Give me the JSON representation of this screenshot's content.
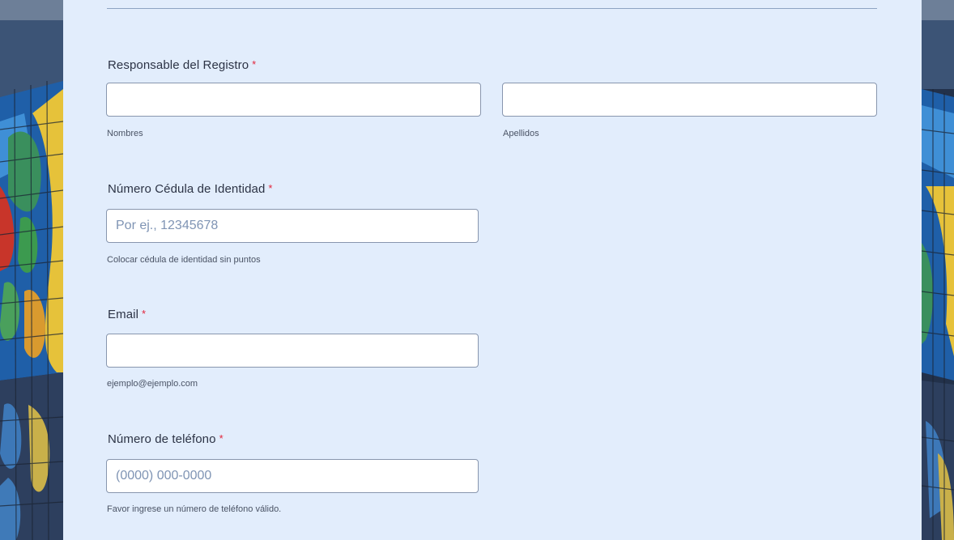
{
  "form": {
    "fields": {
      "name": {
        "label": "Responsable del Registro",
        "required_mark": "*",
        "first_name": {
          "value": "",
          "sublabel": "Nombres"
        },
        "last_name": {
          "value": "",
          "sublabel": "Apellidos"
        }
      },
      "id_number": {
        "label": "Número Cédula de Identidad",
        "required_mark": "*",
        "value": "",
        "placeholder": "Por ej., 12345678",
        "sublabel": "Colocar cédula de identidad sin puntos"
      },
      "email": {
        "label": "Email",
        "required_mark": "*",
        "value": "",
        "sublabel": "ejemplo@ejemplo.com"
      },
      "phone": {
        "label": "Número de teléfono",
        "required_mark": "*",
        "value": "",
        "placeholder": "(0000) 000-0000",
        "sublabel": "Favor ingrese un número de teléfono válido."
      }
    }
  },
  "colors": {
    "form_background": "#e2edfc",
    "required_star": "#e2253b",
    "input_border": "#8896ae",
    "placeholder": "#7f94b4"
  }
}
